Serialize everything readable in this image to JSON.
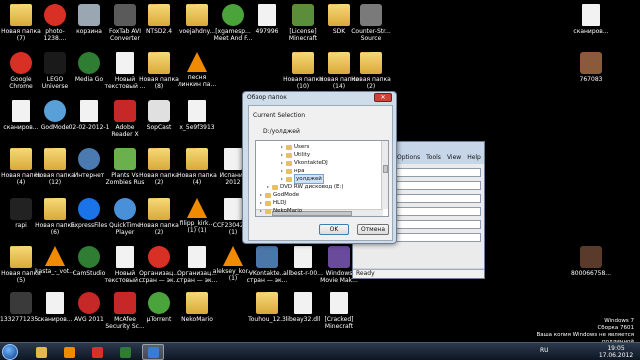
{
  "desktop": {
    "icons": [
      {
        "label": "Новая папка (7)",
        "icon": "folder-icon",
        "color": "#e2b94a"
      },
      {
        "label": "photo-1238....",
        "icon": "chrome-icon",
        "color": "#d93025"
      },
      {
        "label": "корзина",
        "icon": "recycle-bin-icon",
        "color": "#9aa6b2"
      },
      {
        "label": "FoxTab AVI Converter",
        "icon": "foxtab-icon",
        "color": "#5a5a5a"
      },
      {
        "label": "NTSD2.4",
        "icon": "folder-icon",
        "color": "#e2b94a"
      },
      {
        "label": "voejahdny...",
        "icon": "folder-icon",
        "color": "#e2b94a"
      },
      {
        "label": "[xgamesp... Meet And F...",
        "icon": "utorrent-icon",
        "color": "#4aa33b"
      },
      {
        "label": "497996",
        "icon": "document-icon",
        "color": "#f2f2f2"
      },
      {
        "label": "[License] Minecraft",
        "icon": "minecraft-icon",
        "color": "#5c8d3a"
      },
      {
        "label": "SDK",
        "icon": "folder-icon",
        "color": "#e2b94a"
      },
      {
        "label": "Counter-Str... Source",
        "icon": "cs-icon",
        "color": "#7a7a7a"
      },
      {
        "label": "сканиров...",
        "icon": "document-icon",
        "color": "#f2f2f2"
      },
      {
        "label": "Google Chrome",
        "icon": "chrome-icon",
        "color": "#d93025"
      },
      {
        "label": "LEGO Universe",
        "icon": "lego-icon",
        "color": "#1a1a1a"
      },
      {
        "label": "Media Go",
        "icon": "media-go-icon",
        "color": "#2e7d32"
      },
      {
        "label": "Новый текстовый ...",
        "icon": "document-icon",
        "color": "#f2f2f2"
      },
      {
        "label": "Новая папка (8)",
        "icon": "folder-icon",
        "color": "#e2b94a"
      },
      {
        "label": "песня линкин па...",
        "icon": "vlc-icon",
        "color": "#f08a00"
      },
      {
        "label": "Новая папка (10)",
        "icon": "folder-icon",
        "color": "#e2b94a"
      },
      {
        "label": "Новая папка (14)",
        "icon": "folder-icon",
        "color": "#e2b94a"
      },
      {
        "label": "Новая папка (2)",
        "icon": "folder-icon",
        "color": "#e2b94a"
      },
      {
        "label": "767083",
        "icon": "image-icon",
        "color": "#8a5a3a"
      },
      {
        "label": "сканиров...",
        "icon": "document-icon",
        "color": "#f2f2f2"
      },
      {
        "label": "GodMode",
        "icon": "godmode-icon",
        "color": "#5aa0d8"
      },
      {
        "label": "02-02-2012-1",
        "icon": "document-icon",
        "color": "#f2f2f2"
      },
      {
        "label": "Adobe Reader X",
        "icon": "adobe-reader-icon",
        "color": "#c62828"
      },
      {
        "label": "SopCast",
        "icon": "sopcast-icon",
        "color": "#e0e0e0"
      },
      {
        "label": "x_5e9f3913",
        "icon": "document-icon",
        "color": "#f2f2f2"
      },
      {
        "label": "Новая папка (4)",
        "icon": "folder-icon",
        "color": "#e2b94a"
      },
      {
        "label": "Новая папка (12)",
        "icon": "folder-icon",
        "color": "#e2b94a"
      },
      {
        "label": "Интернет",
        "icon": "network-icon",
        "color": "#4a7ab0"
      },
      {
        "label": "Plants Vs Zombies Rus",
        "icon": "plants-vs-zombies-icon",
        "color": "#6ab04c"
      },
      {
        "label": "Новая папка (2)",
        "icon": "folder-icon",
        "color": "#e2b94a"
      },
      {
        "label": "Новая папка (4)",
        "icon": "folder-icon",
        "color": "#e2b94a"
      },
      {
        "label": "Испания 2012",
        "icon": "document-icon",
        "color": "#f2f2f2"
      },
      {
        "label": "rapi",
        "icon": "rap-icon",
        "color": "#222222"
      },
      {
        "label": "Новая папка (6)",
        "icon": "folder-icon",
        "color": "#e2b94a"
      },
      {
        "label": "ExpressFiles",
        "icon": "express-files-icon",
        "color": "#1a73e8"
      },
      {
        "label": "QuickTime Player",
        "icon": "quicktime-icon",
        "color": "#4a90d9"
      },
      {
        "label": "Новая папка (2)",
        "icon": "folder-icon",
        "color": "#e2b94a"
      },
      {
        "label": "filipp_kirk... (1) (1)",
        "icon": "vlc-icon",
        "color": "#f08a00"
      },
      {
        "label": "CCF230420... (1)",
        "icon": "document-icon",
        "color": "#f2f2f2"
      },
      {
        "label": "Новая папка (5)",
        "icon": "folder-icon",
        "color": "#e2b94a"
      },
      {
        "label": "kasta_-_vot...",
        "icon": "vlc-icon",
        "color": "#f08a00"
      },
      {
        "label": "CamStudio",
        "icon": "camstudio-icon",
        "color": "#2e7d32"
      },
      {
        "label": "Новый текстовый ...",
        "icon": "document-icon",
        "color": "#f2f2f2"
      },
      {
        "label": "Организац... стран — эк...",
        "icon": "chrome-icon",
        "color": "#d93025"
      },
      {
        "label": "Организац... стран — эк...",
        "icon": "document-icon",
        "color": "#f2f2f2"
      },
      {
        "label": "aleksey_kor... (1)",
        "icon": "vlc-icon",
        "color": "#f08a00"
      },
      {
        "label": "VKontakte... стран — эк...",
        "icon": "vkontakte-icon",
        "color": "#4a76a8"
      },
      {
        "label": "allbest-r-00...",
        "icon": "document-icon",
        "color": "#f2f2f2"
      },
      {
        "label": "Windows Movie Mak...",
        "icon": "movie-maker-icon",
        "color": "#6a4a9a"
      },
      {
        "label": "800066758...",
        "icon": "image-icon",
        "color": "#5a3a2a"
      },
      {
        "label": "1332771235...",
        "icon": "image-icon",
        "color": "#3a3a3a"
      },
      {
        "label": "сканиров...",
        "icon": "document-icon",
        "color": "#f2f2f2"
      },
      {
        "label": "AVG 2011",
        "icon": "avg-icon",
        "color": "#c62828"
      },
      {
        "label": "McAfee Security Sc...",
        "icon": "mcafee-icon",
        "color": "#c62828"
      },
      {
        "label": "µTorrent",
        "icon": "utorrent-icon",
        "color": "#4aa33b"
      },
      {
        "label": "NekoMario",
        "icon": "folder-icon",
        "color": "#e2b94a"
      },
      {
        "label": "Touhou_12.3",
        "icon": "folder-icon",
        "color": "#e2b94a"
      },
      {
        "label": "libeay32.dll",
        "icon": "dll-icon",
        "color": "#f2f2f2"
      },
      {
        "label": "[Cracked] Minecraft",
        "icon": "document-icon",
        "color": "#f2f2f2"
      },
      {
        "label": "Каста - Мелкие...",
        "icon": "vlc-icon",
        "color": "#f08a00"
      },
      {
        "label": "Steam",
        "icon": "steam-icon",
        "color": "#1b2838"
      }
    ]
  },
  "dialog": {
    "title": "Обзор папок",
    "close_label": "✕",
    "current_selection_label": "Current Selection",
    "current_path": "D:/уолджей",
    "tree": [
      {
        "label": "Users",
        "indent": 3,
        "selected": false
      },
      {
        "label": "Utility",
        "indent": 3,
        "selected": false
      },
      {
        "label": "VkontakteDJ",
        "indent": 3,
        "selected": false
      },
      {
        "label": "нра",
        "indent": 3,
        "selected": false
      },
      {
        "label": "уолджей",
        "indent": 3,
        "selected": true
      },
      {
        "label": "DVD RW дисковод (E:)",
        "indent": 1,
        "selected": false
      },
      {
        "label": "GodMode",
        "indent": 0,
        "selected": false
      },
      {
        "label": "HLDJ",
        "indent": 0,
        "selected": false
      },
      {
        "label": "NekoMario",
        "indent": 0,
        "selected": false
      }
    ],
    "ok_label": "OK",
    "cancel_label": "Отмена"
  },
  "app_window": {
    "menu": [
      "Options",
      "Tools",
      "View",
      "Help"
    ],
    "fields": [
      "19",
      "60 sec",
      "32 bits",
      "Video 1",
      "7.75 fps",
      "X 768"
    ],
    "status": "Ready"
  },
  "taskbar": {
    "buttons": [
      {
        "icon": "explorer-icon",
        "color": "#e2b94a",
        "active": false
      },
      {
        "icon": "media-player-icon",
        "color": "#f08a00",
        "active": false
      },
      {
        "icon": "chrome-icon",
        "color": "#d93025",
        "active": false
      },
      {
        "icon": "camstudio-icon",
        "color": "#2e7d32",
        "active": false
      },
      {
        "icon": "app-window-icon",
        "color": "#3a7bd5",
        "active": true
      }
    ],
    "language": "RU",
    "time": "19:05",
    "date": "17.06.2012"
  },
  "watermark": {
    "line1": "Windows 7",
    "line2": "Сборка 7601",
    "line3": "Ваша копия Windows не является подлинной"
  }
}
